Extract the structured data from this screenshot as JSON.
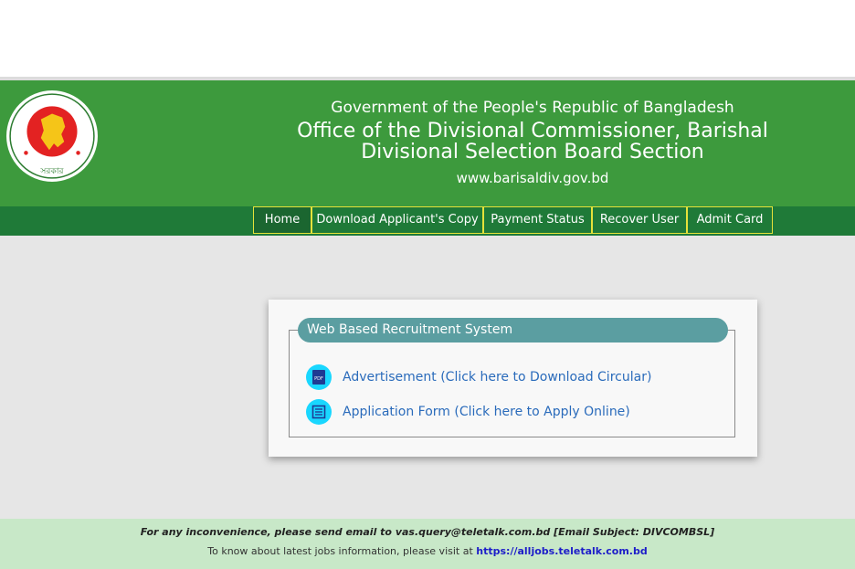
{
  "header": {
    "line1": "Government of the People's Republic of Bangladesh",
    "line2": "Office of the Divisional Commissioner, Barishal",
    "line3": "Divisional Selection Board Section",
    "website": "www.barisaldiv.gov.bd",
    "logo_text_top": "গণপ্রজাতন্ত্রী বাংলাদেশ",
    "logo_text_bottom": "সরকার"
  },
  "nav": {
    "items": [
      {
        "label": "Home"
      },
      {
        "label": "Download Applicant's Copy"
      },
      {
        "label": "Payment Status"
      },
      {
        "label": "Recover User"
      },
      {
        "label": "Admit Card"
      }
    ]
  },
  "panel": {
    "title": "Web Based Recruitment System",
    "links": [
      {
        "label": "Advertisement (Click here to Download Circular)",
        "icon": "pdf-icon"
      },
      {
        "label": "Application Form (Click here to Apply Online)",
        "icon": "form-icon"
      }
    ]
  },
  "footer": {
    "line1": "For any inconvenience, please send email to vas.query@teletalk.com.bd [Email Subject: DIVCOMBSL]",
    "line2_prefix": "To know about latest jobs information, please visit at",
    "line2_link": "https://alljobs.teletalk.com.bd"
  },
  "colors": {
    "banner": "#3d9a3d",
    "nav_bar": "#1f7a38",
    "nav_border": "#e5e23a",
    "legend": "#5b9ea1",
    "link": "#2a6bbb",
    "footer_bg": "#c8e8c8"
  }
}
